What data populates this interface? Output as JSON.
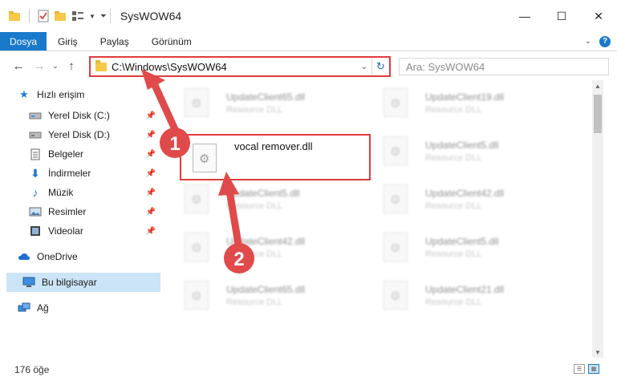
{
  "window": {
    "title": "SysWOW64",
    "controls": {
      "minimize": "—",
      "maximize": "☐",
      "close": "✕"
    }
  },
  "ribbon": {
    "tabs": [
      {
        "label": "Dosya",
        "active": true
      },
      {
        "label": "Giriş",
        "active": false
      },
      {
        "label": "Paylaş",
        "active": false
      },
      {
        "label": "Görünüm",
        "active": false
      }
    ],
    "help": "?"
  },
  "addressbar": {
    "path": "C:\\Windows\\SysWOW64",
    "search_placeholder": "Ara: SysWOW64"
  },
  "navpane": {
    "items": [
      {
        "label": "Hızlı erişim",
        "icon": "star-icon",
        "pinned": false
      },
      {
        "label": "Yerel Disk (C:)",
        "icon": "drive-icon",
        "pinned": true
      },
      {
        "label": "Yerel Disk (D:)",
        "icon": "drive-icon",
        "pinned": true
      },
      {
        "label": "Belgeler",
        "icon": "document-icon",
        "pinned": true
      },
      {
        "label": "İndirmeler",
        "icon": "download-icon",
        "pinned": true
      },
      {
        "label": "Müzik",
        "icon": "music-icon",
        "pinned": true
      },
      {
        "label": "Resimler",
        "icon": "pictures-icon",
        "pinned": true
      },
      {
        "label": "Videolar",
        "icon": "video-icon",
        "pinned": true
      },
      {
        "label": "OneDrive",
        "icon": "cloud-icon",
        "pinned": false
      },
      {
        "label": "Bu bilgisayar",
        "icon": "computer-icon",
        "pinned": false,
        "selected": true
      },
      {
        "label": "Ağ",
        "icon": "network-icon",
        "pinned": false
      }
    ]
  },
  "files": {
    "highlighted": {
      "name": "vocal remover.dll"
    },
    "blurred": [
      {
        "name": "UpdateClient65.dll",
        "type": "Resource DLL"
      },
      {
        "name": "UpdateClient19.dll",
        "type": "Resource DLL"
      },
      {
        "name": "UpdateClient5.dll",
        "type": "Resource DLL"
      },
      {
        "name": "UpdateClient5.dll",
        "type": "Resource DLL"
      },
      {
        "name": "UpdateClient42.dll",
        "type": "Resource DLL"
      },
      {
        "name": "UpdateClient42.dll",
        "type": "Resource DLL"
      },
      {
        "name": "UpdateClient5.dll",
        "type": "Resource DLL"
      },
      {
        "name": "UpdateClient65.dll",
        "type": "Resource DLL"
      },
      {
        "name": "UpdateClient21.dll",
        "type": "Resource DLL"
      }
    ]
  },
  "annotations": {
    "step1": "1",
    "step2": "2",
    "color": "#e04a4a"
  },
  "status": {
    "item_count": "176 öğe"
  },
  "colors": {
    "accent": "#1979ca",
    "highlight": "#e03b3b",
    "selected_bg": "#cce4f7"
  }
}
